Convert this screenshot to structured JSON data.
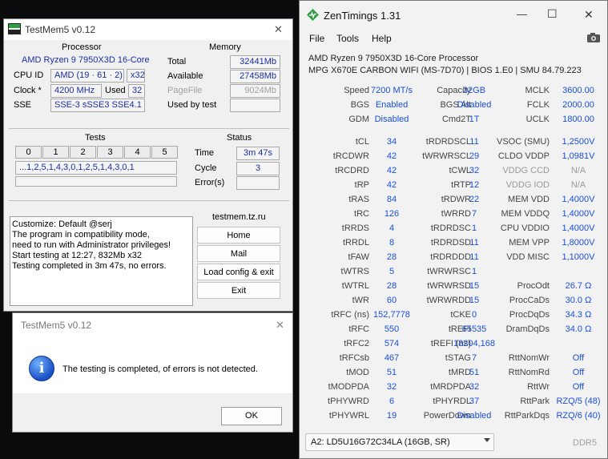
{
  "tm_main": {
    "title": "TestMem5 v0.12",
    "close_glyph": "✕",
    "processor_label": "Processor",
    "processor_name": "AMD Ryzen 9 7950X3D 16-Core",
    "cpuid_label": "CPU ID",
    "cpuid_value": "AMD  (19 · 61 · 2)",
    "cpuid_arch": "x32",
    "clock_label": "Clock *",
    "clock_value": "4200 MHz",
    "used_label": "Used",
    "used_value": "32",
    "sse_label": "SSE",
    "sse_value": "SSE-3 sSSE3 SSE4.1",
    "memory_label": "Memory",
    "total_label": "Total",
    "total_value": "32441Mb",
    "available_label": "Available",
    "available_value": "27458Mb",
    "pagefile_label": "PageFile",
    "pagefile_value": "9024Mb",
    "usedbytest_label": "Used by test",
    "usedbytest_value": "",
    "tests_label": "Tests",
    "test_cells": [
      "0",
      "1",
      "2",
      "3",
      "4",
      "5"
    ],
    "test_sequence": "...1,2,5,1,4,3,0,1,2,5,1,4,3,0,1",
    "status_label": "Status",
    "time_label": "Time",
    "time_value": "3m 47s",
    "cycle_label": "Cycle",
    "cycle_value": "3",
    "errors_label": "Error(s)",
    "errors_value": "",
    "log": "Customize: Default @serj\nThe program in compatibility mode,\nneed to run with Administrator privileges!\nStart testing at 12:27, 832Mb x32\nTesting completed in 3m 47s, no errors.",
    "site": "testmem.tz.ru",
    "btn_home": "Home",
    "btn_mail": "Mail",
    "btn_load": "Load config & exit",
    "btn_exit": "Exit"
  },
  "tm_dialog": {
    "title": "TestMem5 v0.12",
    "close_glyph": "✕",
    "info_glyph": "i",
    "message": "The testing is completed, of errors is not detected.",
    "ok_label": "OK"
  },
  "zt": {
    "title": "ZenTimings 1.31",
    "win_min": "—",
    "win_max": "☐",
    "win_close": "✕",
    "menu": [
      "File",
      "Tools",
      "Help"
    ],
    "cpu": "AMD Ryzen 9 7950X3D 16-Core Processor",
    "board": "MPG X670E CARBON WIFI (MS-7D70) | BIOS 1.E0 | SMU 84.79.223",
    "top_rows": [
      [
        "Speed",
        "7200 MT/s",
        "Capacity",
        "32GB",
        "MCLK",
        "3600.00"
      ],
      [
        "BGS",
        "Enabled",
        "BGS Alt",
        "Disabled",
        "FCLK",
        "2000.00"
      ],
      [
        "GDM",
        "Disabled",
        "Cmd2T",
        "1T",
        "UCLK",
        "1800.00"
      ]
    ],
    "timings": [
      [
        "tCL",
        "34",
        "tRDRDSCL",
        "11",
        "VSOC (SMU)",
        "1,2500V"
      ],
      [
        "tRCDWR",
        "42",
        "tWRWRSCL",
        "29",
        "CLDO VDDP",
        "1,0981V"
      ],
      [
        "tRCDRD",
        "42",
        "tCWL",
        "32",
        "VDDG CCD",
        "N/A"
      ],
      [
        "tRP",
        "42",
        "tRTP",
        "12",
        "VDDG IOD",
        "N/A"
      ],
      [
        "tRAS",
        "84",
        "tRDWR",
        "22",
        "MEM VDD",
        "1,4000V"
      ],
      [
        "tRC",
        "126",
        "tWRRD",
        "7",
        "MEM VDDQ",
        "1,4000V"
      ],
      [
        "tRRDS",
        "4",
        "tRDRDSC",
        "1",
        "CPU VDDIO",
        "1,4000V"
      ],
      [
        "tRRDL",
        "8",
        "tRDRDSD",
        "11",
        "MEM VPP",
        "1,8000V"
      ],
      [
        "tFAW",
        "28",
        "tRDRDDD",
        "11",
        "VDD MISC",
        "1,1000V"
      ],
      [
        "tWTRS",
        "5",
        "tWRWRSC",
        "1",
        "",
        ""
      ],
      [
        "tWTRL",
        "28",
        "tWRWRSD",
        "15",
        "ProcOdt",
        "26.7 Ω"
      ],
      [
        "tWR",
        "60",
        "tWRWRDD",
        "15",
        "ProcCaDs",
        "30.0 Ω"
      ],
      [
        "tRFC (ns)",
        "152,7778",
        "tCKE",
        "0",
        "ProcDqDs",
        "34.3 Ω"
      ],
      [
        "tRFC",
        "550",
        "tREFI",
        "65535",
        "DramDqDs",
        "34.0 Ω"
      ],
      [
        "tRFC2",
        "574",
        "tREFI (ns)",
        "18204,168",
        "",
        ""
      ],
      [
        "tRFCsb",
        "467",
        "tSTAG",
        "7",
        "RttNomWr",
        "Off"
      ],
      [
        "tMOD",
        "51",
        "tMRD",
        "51",
        "RttNomRd",
        "Off"
      ],
      [
        "tMODPDA",
        "32",
        "tMRDPDA",
        "32",
        "RttWr",
        "Off"
      ],
      [
        "tPHYWRD",
        "6",
        "tPHYRDL",
        "37",
        "RttPark",
        "RZQ/5 (48)"
      ],
      [
        "tPHYWRL",
        "19",
        "PowerDown",
        "Disabled",
        "RttParkDqs",
        "RZQ/6 (40)"
      ]
    ],
    "dimm_selected": "A2: LD5U16G72C34LA (16GB, SR)",
    "ddr": "DDR5"
  }
}
